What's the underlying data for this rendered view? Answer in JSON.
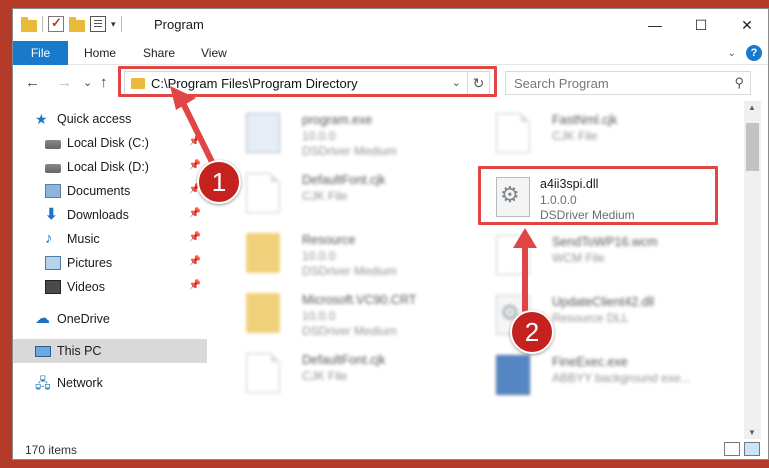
{
  "window": {
    "title": "Program",
    "controls": {
      "minimize": "—",
      "maximize": "☐",
      "close": "✕"
    }
  },
  "ribbon": {
    "file_tab": "File",
    "tabs": [
      "Home",
      "Share",
      "View"
    ]
  },
  "nav": {
    "back": "←",
    "forward": "→",
    "recent": "⌄",
    "up": "↑",
    "address_path": "C:\\Program Files\\Program Directory",
    "refresh": "↻",
    "search_placeholder": "Search Program"
  },
  "sidebar": {
    "items": [
      {
        "label": "Quick access"
      },
      {
        "label": "Local Disk (C:)"
      },
      {
        "label": "Local Disk (D:)"
      },
      {
        "label": "Documents"
      },
      {
        "label": "Downloads"
      },
      {
        "label": "Music"
      },
      {
        "label": "Pictures"
      },
      {
        "label": "Videos"
      },
      {
        "label": "OneDrive"
      },
      {
        "label": "This PC"
      },
      {
        "label": "Network"
      }
    ]
  },
  "files": [
    {
      "name": "program.exe",
      "line2": "10.0.0",
      "line3": "DSDriver Medium",
      "icon": "exe-icon"
    },
    {
      "name": "FastNml.cjk",
      "line2": "CJK File",
      "line3": "",
      "icon": "file-icon"
    },
    {
      "name": "DefaultFont.cjk",
      "line2": "CJK File",
      "line3": "",
      "icon": "file-icon"
    },
    {
      "name": "a4ii3spi.dll",
      "line2": "1.0.0.0",
      "line3": "DSDriver Medium",
      "icon": "gear-file-icon"
    },
    {
      "name": "Resource",
      "line2": "10.0.0",
      "line3": "DSDriver Medium",
      "icon": "folder-icon"
    },
    {
      "name": "SendToWP16.wcm",
      "line2": "WCM File",
      "line3": "",
      "icon": "file-icon"
    },
    {
      "name": "Microsoft.VC90.CRT",
      "line2": "10.0.0",
      "line3": "DSDriver Medium",
      "icon": "folder-icon"
    },
    {
      "name": "UpdateClient42.dll",
      "line2": "Resource DLL",
      "line3": "",
      "icon": "gear-file-icon"
    },
    {
      "name": "DefaultFont.cjk",
      "line2": "CJK File",
      "line3": "",
      "icon": "file-icon"
    },
    {
      "name": "FineExec.exe",
      "line2": "ABBYY background exe...",
      "line3": "",
      "icon": "app-icon"
    }
  ],
  "status": {
    "item_count": "170 items"
  },
  "annotations": {
    "step1": "1",
    "step2": "2",
    "highlight_color": "#e04646",
    "badge_color": "#c4211f"
  }
}
